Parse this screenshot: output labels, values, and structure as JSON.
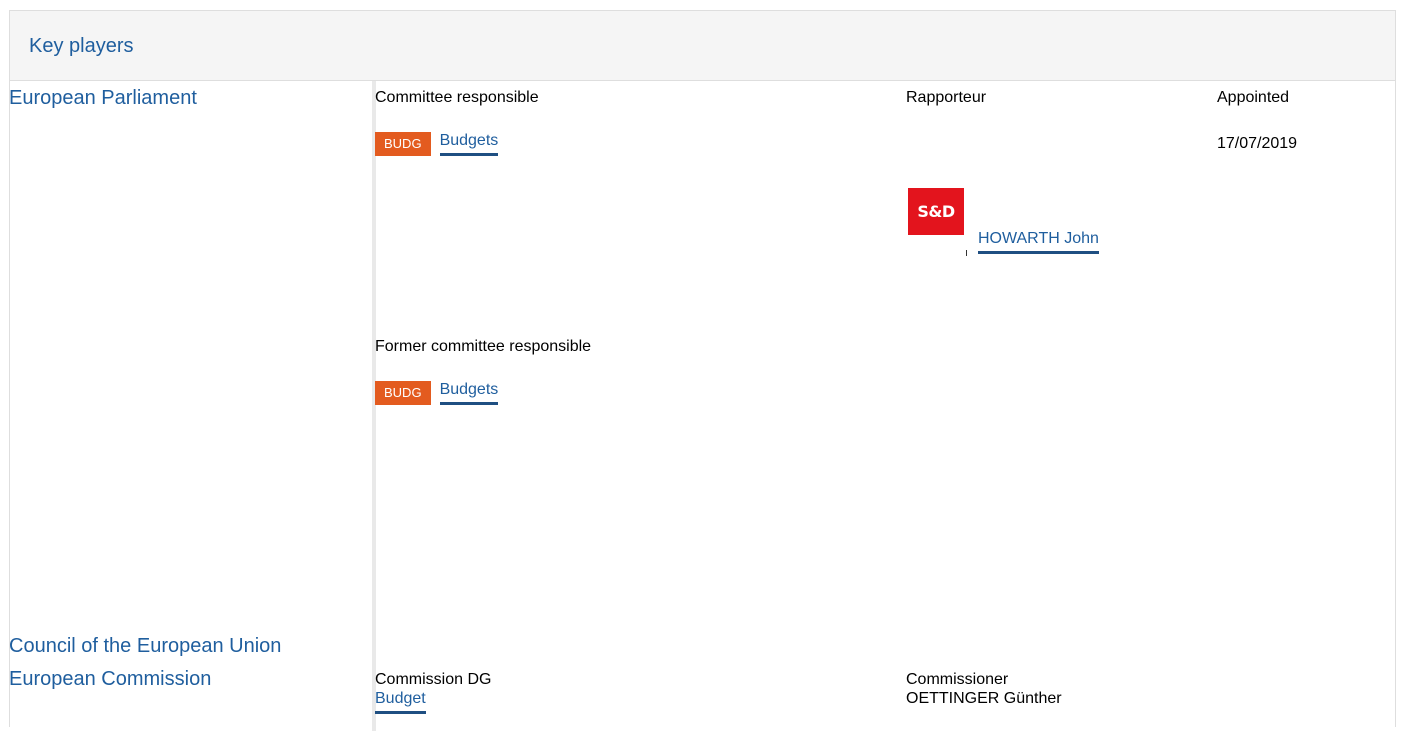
{
  "panel": {
    "title": "Key players"
  },
  "parliament": {
    "institution": "European Parliament",
    "headers": {
      "committee_responsible": "Committee responsible",
      "rapporteur": "Rapporteur",
      "appointed": "Appointed"
    },
    "committee": {
      "badge": "BUDG",
      "name": "Budgets"
    },
    "appointed_date": "17/07/2019",
    "rapporteur": {
      "group_logo": "S&D",
      "group_color": "#e3141d",
      "name": "HOWARTH John"
    },
    "former_committee_label": "Former committee responsible",
    "former_committee": {
      "badge": "BUDG",
      "name": "Budgets"
    }
  },
  "council": {
    "institution": "Council of the European Union"
  },
  "commission": {
    "institution": "European Commission",
    "headers": {
      "dg": "Commission DG",
      "commissioner": "Commissioner"
    },
    "dg_name": "Budget",
    "commissioner_name": "OETTINGER Günther"
  },
  "colors": {
    "accent": "#1f5e9e",
    "badge": "#e35b1f",
    "header_bg": "#f5f5f5"
  }
}
